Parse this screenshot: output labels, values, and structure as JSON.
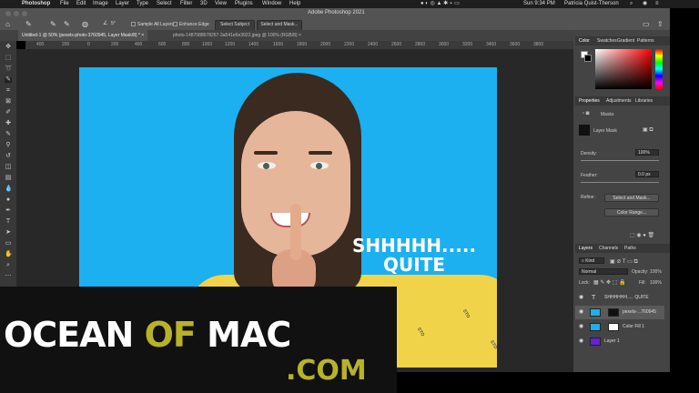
{
  "menubar": {
    "app": "Photoshop",
    "items": [
      "File",
      "Edit",
      "Image",
      "Layer",
      "Type",
      "Select",
      "Filter",
      "3D",
      "View",
      "Plugins",
      "Window",
      "Help"
    ],
    "clock": "Sun 9:34 PM",
    "user": "Patricia Quist-Therson"
  },
  "window": {
    "title": "Adobe Photoshop 2021"
  },
  "options": {
    "size_value": "5°",
    "sample_all_layers": "Sample All Layers",
    "enhance_edge": "Enhance Edge",
    "select_subject": "Select Subject",
    "select_and_mask": "Select and Mask..."
  },
  "tabs": [
    "Untitled-1 @ 50% (pexels-photo-3760945, Layer Mask/8) *",
    "photo-1487088678257-3a541e6e3922.jpeg @ 100% (RGB/8)"
  ],
  "ruler": [
    "400",
    "200",
    "0",
    "200",
    "400",
    "600",
    "800",
    "1000",
    "1200",
    "1400",
    "1600",
    "1800",
    "2000",
    "2200",
    "2400",
    "2600",
    "2800",
    "3000",
    "3200",
    "3400",
    "3600",
    "3800"
  ],
  "canvas": {
    "line1": "SHHHHH.....",
    "line2": "QUITE",
    "shirt_text": "STO"
  },
  "color_panel": {
    "tabs": [
      "Color",
      "Swatches",
      "Gradient",
      "Patterns"
    ]
  },
  "properties_panel": {
    "tabs": [
      "Properties",
      "Adjustments",
      "Libraries"
    ],
    "section": "Masks",
    "layer_mask": "Layer Mask",
    "density_label": "Density:",
    "density_value": "100%",
    "feather_label": "Feather:",
    "feather_value": "0.0 px",
    "refine_label": "Refine:",
    "select_and_mask": "Select and Mask...",
    "color_range": "Color Range..."
  },
  "layers_panel": {
    "tabs": [
      "Layers",
      "Channels",
      "Paths"
    ],
    "filter": "Kind",
    "blend_mode": "Normal",
    "opacity_label": "Opacity:",
    "opacity_value": "100%",
    "lock_label": "Lock:",
    "fill_label": "Fill:",
    "fill_value": "100%",
    "layers": [
      {
        "name": "SHHHHHH..... QUITE",
        "kind": "text"
      },
      {
        "name": "pexels-...760945",
        "kind": "image"
      },
      {
        "name": "Color Fill 1",
        "kind": "fill"
      },
      {
        "name": "Layer 1",
        "kind": "layer"
      }
    ]
  },
  "watermark": {
    "part1": "OCEAN",
    "part2": "OF",
    "part3": "MAC",
    "part4": ".COM"
  },
  "colors": {
    "canvas_bg": "#1cb0f0",
    "panel_bg": "#444444",
    "watermark_white": "#ffffff",
    "watermark_gold": "#b8b22a",
    "hue_red": "#ff0000"
  },
  "icons": [
    "apple-icon",
    "move-icon",
    "marquee-icon",
    "lasso-icon",
    "quick-select-icon",
    "crop-icon",
    "eyedropper-icon",
    "brush-icon",
    "stamp-icon",
    "eraser-icon",
    "gradient-icon",
    "pen-icon",
    "type-icon",
    "hand-icon",
    "zoom-icon",
    "eye-icon"
  ]
}
